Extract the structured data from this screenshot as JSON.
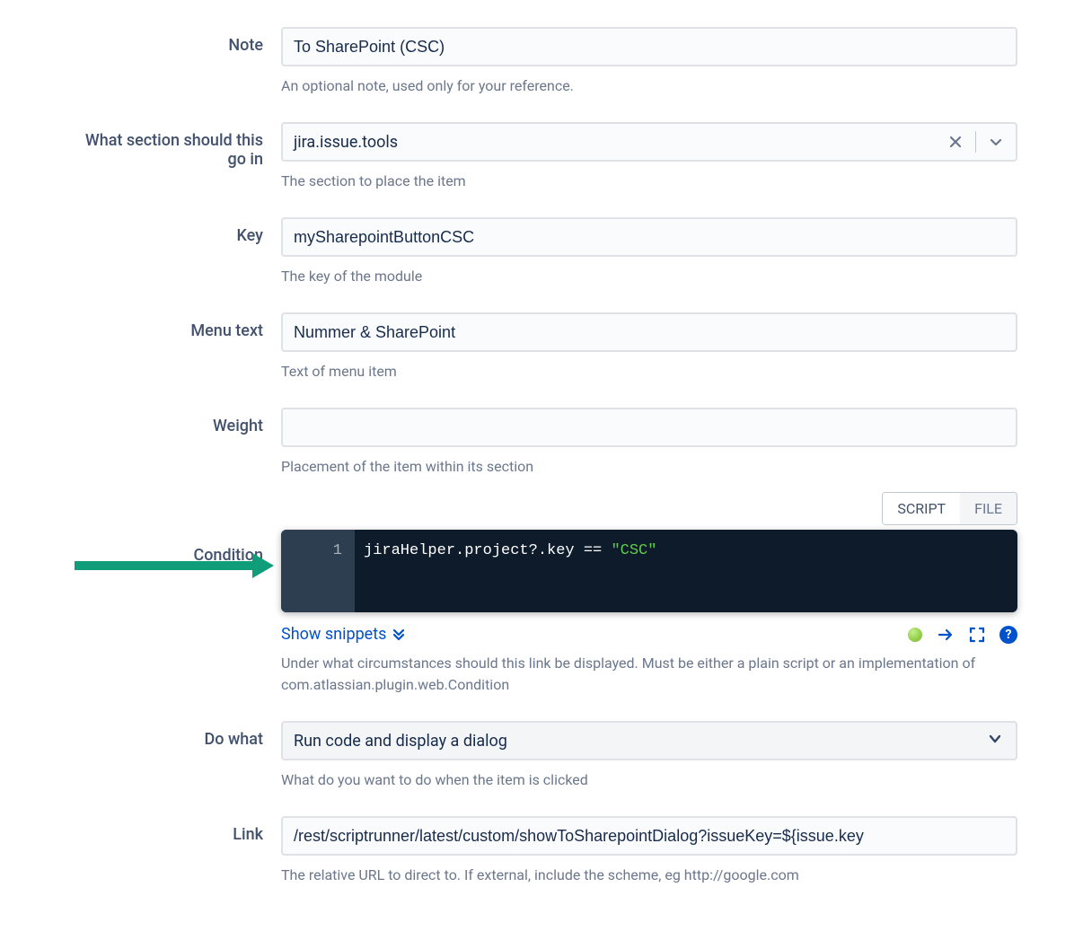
{
  "note": {
    "label": "Note",
    "value": "To SharePoint (CSC)",
    "help": "An optional note, used only for your reference."
  },
  "section": {
    "label": "What section should this go in",
    "value": "jira.issue.tools",
    "help": "The section to place the item"
  },
  "key": {
    "label": "Key",
    "value": "mySharepointButtonCSC",
    "help": "The key of the module"
  },
  "menu_text": {
    "label": "Menu text",
    "value": "Nummer & SharePoint",
    "help": "Text of menu item"
  },
  "weight": {
    "label": "Weight",
    "value": "",
    "help": "Placement of the item within its section"
  },
  "condition": {
    "label": "Condition",
    "tabs": {
      "script": "SCRIPT",
      "file": "FILE"
    },
    "line_no": "1",
    "code_plain": "jiraHelper.project?.key == ",
    "code_string": "\"CSC\"",
    "show_snippets": "Show snippets",
    "help": "Under what circumstances should this link be displayed. Must be either a plain script or an implementation of com.atlassian.plugin.web.Condition"
  },
  "do_what": {
    "label": "Do what",
    "value": "Run code and display a dialog",
    "help": "What do you want to do when the item is clicked"
  },
  "link": {
    "label": "Link",
    "value": "/rest/scriptrunner/latest/custom/showToSharepointDialog?issueKey=${issue.key",
    "help": "The relative URL to direct to. If external, include the scheme, eg http://google.com"
  }
}
